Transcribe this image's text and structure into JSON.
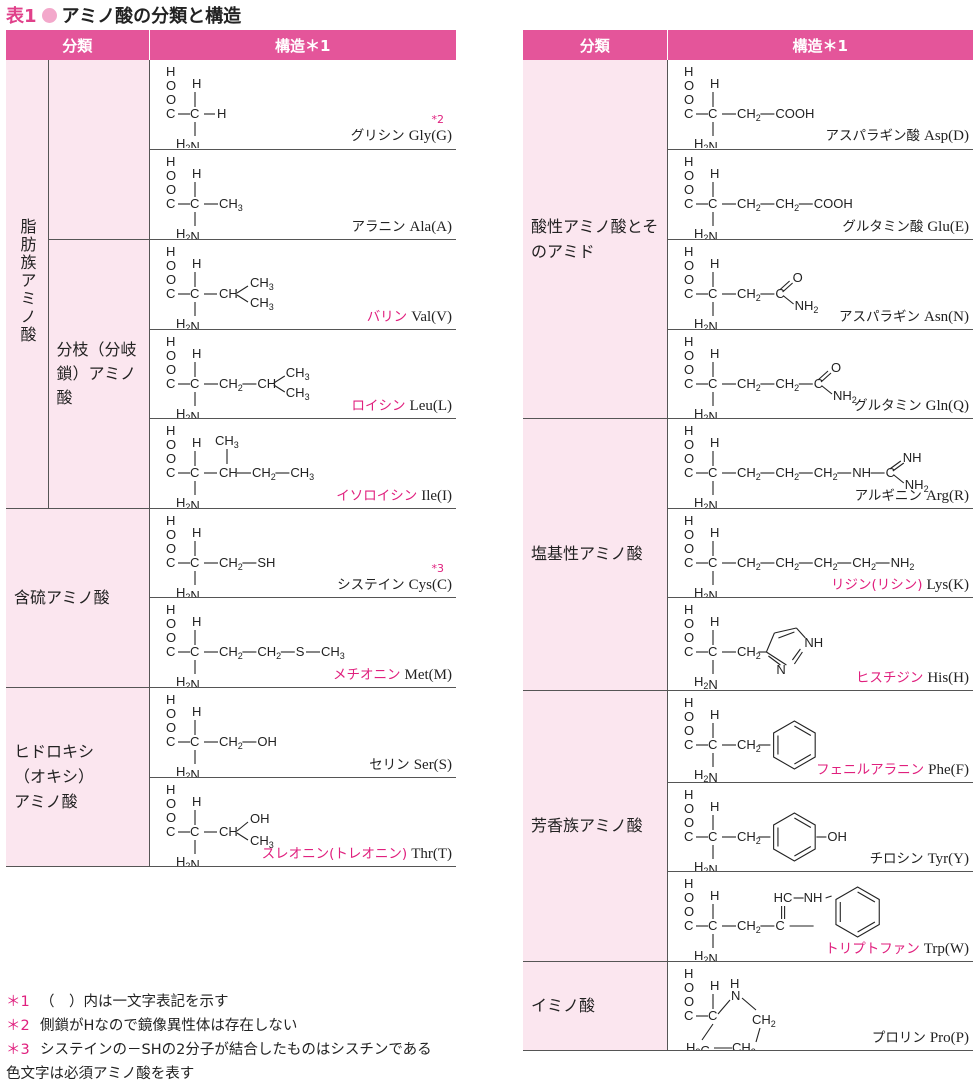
{
  "title": {
    "prefix": "表1",
    "text": "アミノ酸の分類と構造"
  },
  "headers": {
    "category": "分類",
    "structure": "構造＊1"
  },
  "left_groups": [
    {
      "label": "脂肪族アミノ酸",
      "sub": ""
    },
    {
      "label": "分枝（分岐鎖）アミノ酸"
    },
    {
      "label": "含硫アミノ酸"
    },
    {
      "label": "ヒドロキシ（オキシ）アミノ酸"
    }
  ],
  "right_groups": [
    {
      "label": "酸性アミノ酸とそのアミド"
    },
    {
      "label": "塩基性アミノ酸"
    },
    {
      "label": "芳香族アミノ酸"
    },
    {
      "label": "イミノ酸"
    }
  ],
  "aminos": {
    "gly": {
      "jp": "グリシン",
      "ab": "Gly(G)",
      "essential": false,
      "sup": "＊2",
      "side": "H"
    },
    "ala": {
      "jp": "アラニン",
      "ab": "Ala(A)",
      "essential": false,
      "side": "CH3"
    },
    "val": {
      "jp": "バリン",
      "ab": "Val(V)",
      "essential": true
    },
    "leu": {
      "jp": "ロイシン",
      "ab": "Leu(L)",
      "essential": true
    },
    "ile": {
      "jp": "イソロイシン",
      "ab": "Ile(I)",
      "essential": true
    },
    "cys": {
      "jp": "システイン",
      "ab": "Cys(C)",
      "essential": false,
      "sup": "＊3"
    },
    "met": {
      "jp": "メチオニン",
      "ab": "Met(M)",
      "essential": true
    },
    "ser": {
      "jp": "セリン",
      "ab": "Ser(S)",
      "essential": false
    },
    "thr": {
      "jp": "スレオニン(トレオニン)",
      "ab": "Thr(T)",
      "essential": true
    },
    "asp": {
      "jp": "アスパラギン酸",
      "ab": "Asp(D)",
      "essential": false
    },
    "glu": {
      "jp": "グルタミン酸",
      "ab": "Glu(E)",
      "essential": false
    },
    "asn": {
      "jp": "アスパラギン",
      "ab": "Asn(N)",
      "essential": false
    },
    "gln": {
      "jp": "グルタミン",
      "ab": "Gln(Q)",
      "essential": false
    },
    "arg": {
      "jp": "アルギニン",
      "ab": "Arg(R)",
      "essential": false
    },
    "lys": {
      "jp": "リジン(リシン)",
      "ab": "Lys(K)",
      "essential": true
    },
    "his": {
      "jp": "ヒスチジン",
      "ab": "His(H)",
      "essential": true
    },
    "phe": {
      "jp": "フェニルアラニン",
      "ab": "Phe(F)",
      "essential": true
    },
    "tyr": {
      "jp": "チロシン",
      "ab": "Tyr(Y)",
      "essential": false
    },
    "trp": {
      "jp": "トリプトファン",
      "ab": "Trp(W)",
      "essential": true
    },
    "pro": {
      "jp": "プロリン",
      "ab": "Pro(P)",
      "essential": false
    }
  },
  "chem": {
    "H": "H",
    "O": "O",
    "C": "C",
    "H2N": "H2N",
    "CH": "CH",
    "CH2": "CH2",
    "CH3": "CH3",
    "SH": "SH",
    "S": "S",
    "OH": "OH",
    "COOH": "COOH",
    "NH2": "NH2",
    "NH": "NH",
    "N": "N",
    "HC": "HC",
    "H2C": "H2C"
  },
  "notes": [
    {
      "mark": "＊1",
      "text": "（　）内は一文字表記を示す"
    },
    {
      "mark": "＊2",
      "text": "側鎖がHなので鏡像異性体は存在しない"
    },
    {
      "mark": "＊3",
      "text": "システインの－SHの2分子が結合したものはシスチンである"
    },
    {
      "mark": "",
      "text": "色文字は必須アミノ酸を表す"
    }
  ],
  "colors": {
    "header": "#e4559a",
    "category_bg": "#fbe6ef",
    "essential": "#e0207e"
  }
}
